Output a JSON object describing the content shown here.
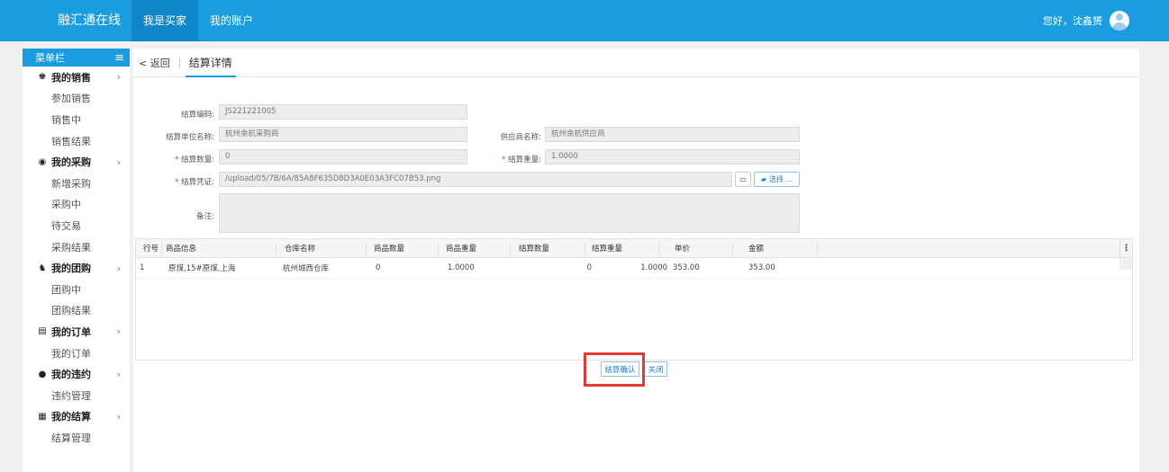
{
  "header": {
    "brand": "融汇通在线",
    "nav": [
      {
        "label": "我是买家",
        "active": true
      },
      {
        "label": "我的账户",
        "active": false
      }
    ],
    "greeting": "您好，沈鑫赟"
  },
  "sidebar": {
    "title": "菜单栏",
    "groups": [
      {
        "label": "我的销售",
        "icon": "seller-icon",
        "items": [
          "参加销售",
          "销售中",
          "销售结果"
        ]
      },
      {
        "label": "我的采购",
        "icon": "search-icon",
        "items": [
          "新增采购",
          "采购中",
          "待交易",
          "采购结果"
        ]
      },
      {
        "label": "我的团购",
        "icon": "group-icon",
        "items": [
          "团购中",
          "团购结果"
        ]
      },
      {
        "label": "我的订单",
        "icon": "document-icon",
        "items": [
          "我的订单"
        ]
      },
      {
        "label": "我的违约",
        "icon": "warning-icon",
        "items": [
          "违约管理"
        ]
      },
      {
        "label": "我的结算",
        "icon": "calculator-icon",
        "items": [
          "结算管理"
        ]
      }
    ]
  },
  "tabs": {
    "back": "< 返回",
    "title": "结算详情"
  },
  "form": {
    "code_label": "结算编码:",
    "code_value": "JS221221005",
    "unit_label": "结算单位名称:",
    "unit_value": "杭州余杭采购商",
    "supplier_label": "供应商名称:",
    "supplier_value": "杭州余杭供应商",
    "qty_label": "结算数量:",
    "qty_value": "0",
    "weight_label": "结算重量:",
    "weight_value": "1.0000",
    "voucher_label": "结算凭证:",
    "voucher_value": "/upload/05/7B/6A/85A8F635D8D3A0E03A3FC07B53.png",
    "choose_label": "选择 ...",
    "remark_label": "备注:",
    "remark_value": ""
  },
  "grid": {
    "columns": [
      "行号",
      "商品信息",
      "仓库名称",
      "商品数量",
      "商品重量",
      "结算数量",
      "结算重量",
      "单价",
      "金额"
    ],
    "rows": [
      {
        "no": "1",
        "info": "原煤,15#原煤,上海",
        "warehouse": "杭州城西仓库",
        "goods_qty": "0",
        "goods_weight": "1.0000",
        "settle_qty": "0",
        "settle_weight": "1.0000",
        "price": "353.00",
        "amount": "353.00"
      }
    ]
  },
  "actions": {
    "confirm": "结算确认",
    "close": "关闭"
  },
  "colors": {
    "primary": "#1a9de0",
    "highlight": "#e53935"
  }
}
